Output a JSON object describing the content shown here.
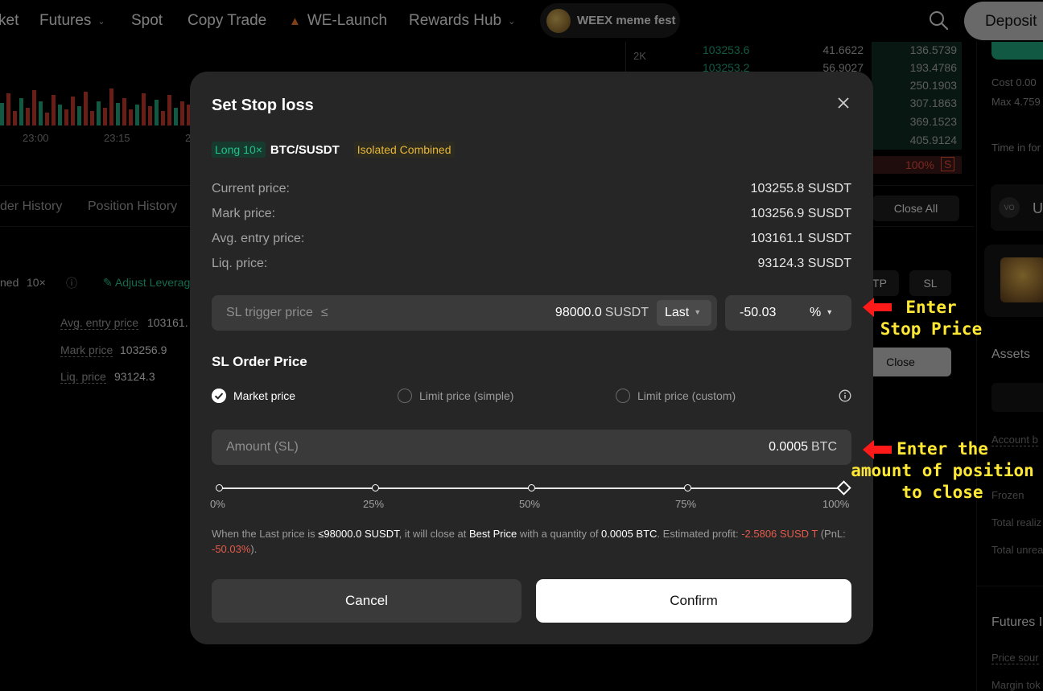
{
  "nav": {
    "items": [
      {
        "label": "ket"
      },
      {
        "label": "Futures"
      },
      {
        "label": "Spot"
      },
      {
        "label": "Copy Trade"
      },
      {
        "label": "WE-Launch"
      },
      {
        "label": "Rewards Hub"
      }
    ],
    "meme_fest": "WEEX meme fest",
    "deposit": "Deposit"
  },
  "background": {
    "chart_axis": {
      "y_tick": "2K",
      "x_ticks": [
        "23:00",
        "23:15",
        "2"
      ]
    },
    "orderbook": [
      {
        "price": "103253.6",
        "qty": "41.6622",
        "total": "136.5739"
      },
      {
        "price": "103253.2",
        "qty": "56.9027",
        "total": "193.4786"
      },
      {
        "price": "",
        "qty": "",
        "total": "250.1903"
      },
      {
        "price": "",
        "qty": "",
        "total": "307.1863"
      },
      {
        "price": "",
        "qty": "",
        "total": "369.1523"
      },
      {
        "price": "",
        "qty": "",
        "total": "405.9124"
      }
    ],
    "ratio_pct": "100%",
    "ratio_badge": "S",
    "tabs": [
      "der History",
      "Position History"
    ],
    "close_all": "Close All",
    "position": {
      "mode": "ned",
      "leverage": "10×",
      "adjust": "Adjust Leverag",
      "avg_entry_label": "Avg. entry price",
      "avg_entry_value": "103161.",
      "mark_label": "Mark price",
      "mark_value": "103256.9",
      "liq_label": "Liq. price",
      "liq_value": "93124.3"
    },
    "tp": "TP",
    "sl": "SL",
    "close": "Close",
    "right": {
      "cost": "Cost 0.00",
      "max": "Max 4.759",
      "time_in_force": "Time in for",
      "u": "U",
      "vo": "VO",
      "assets": "Assets",
      "account": "Account b",
      "frozen": "Frozen",
      "total_realized": "Total realiz",
      "total_unrealized": "Total unrea",
      "futures": "Futures I",
      "price_source": "Price sour",
      "margin": "Margin tok"
    }
  },
  "modal": {
    "title": "Set Stop loss",
    "side": "Long",
    "leverage": "10×",
    "pair": "BTC/SUSDT",
    "margin_mode": "Isolated Combined",
    "info": [
      {
        "label": "Current price:",
        "value": "103255.8 SUSDT"
      },
      {
        "label": "Mark price:",
        "value": "103256.9 SUSDT"
      },
      {
        "label": "Avg. entry price:",
        "value": "103161.1 SUSDT"
      },
      {
        "label": "Liq. price:",
        "value": "93124.3 SUSDT"
      }
    ],
    "trigger": {
      "label": "SL trigger price",
      "operator": "≤",
      "value": "98000.0",
      "unit": "SUSDT",
      "price_type": "Last"
    },
    "percent": {
      "value": "-50.03",
      "unit": "%"
    },
    "order_price_title": "SL Order Price",
    "order_types": [
      "Market price",
      "Limit price (simple)",
      "Limit price (custom)"
    ],
    "selected_order_type": 0,
    "amount": {
      "label": "Amount (SL)",
      "value": "0.0005",
      "unit": "BTC"
    },
    "slider": {
      "value_pct": 100,
      "labels": [
        "0%",
        "25%",
        "50%",
        "75%",
        "100%"
      ]
    },
    "summary": {
      "p1": "When the Last price is ",
      "b1": "≤98000.0 SUSDT",
      "p2": ", it will close at ",
      "b2": "Best Price",
      "p3": " with a quantity of ",
      "b3": "0.0005 BTC",
      "p4": ". Estimated profit: ",
      "r1": "-2.5806 SUSD T",
      "p5": " (PnL: ",
      "r2": "-50.03%",
      "p6": ")."
    },
    "cancel": "Cancel",
    "confirm": "Confirm"
  },
  "annotations": {
    "stop_price": "Enter\nStop Price",
    "amount": "Enter the\namount of position\nto close",
    "color": "#ffe834",
    "arrow_color": "#ff1a1a"
  }
}
